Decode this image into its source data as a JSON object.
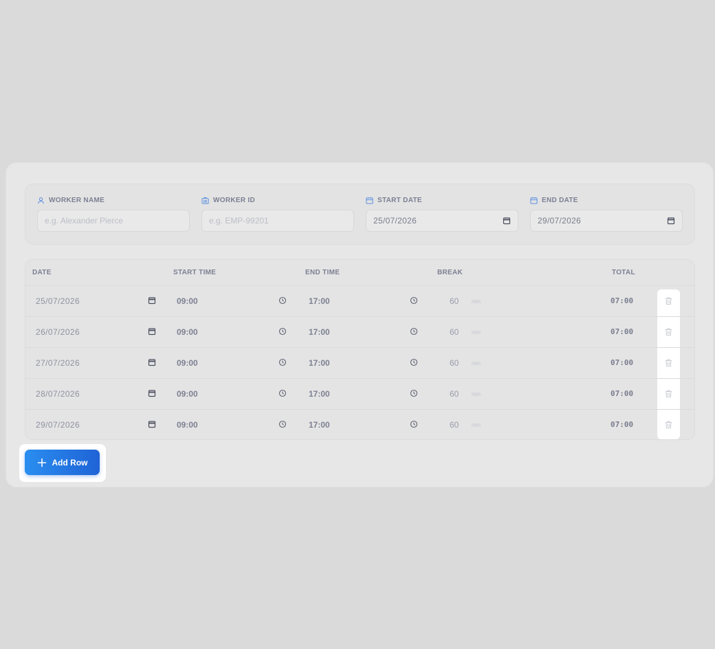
{
  "header": {
    "worker_name": {
      "label": "WORKER NAME",
      "placeholder": "e.g. Alexander Pierce",
      "value": ""
    },
    "worker_id": {
      "label": "WORKER ID",
      "placeholder": "e.g. EMP-99201",
      "value": ""
    },
    "start_date": {
      "label": "START DATE",
      "value": "25/07/2026"
    },
    "end_date": {
      "label": "END DATE",
      "value": "29/07/2026"
    }
  },
  "table": {
    "columns": {
      "date": "DATE",
      "start_time": "START TIME",
      "end_time": "END TIME",
      "break": "BREAK",
      "total": "TOTAL"
    },
    "break_unit": "min",
    "rows": [
      {
        "date": "25/07/2026",
        "start": "09:00",
        "end": "17:00",
        "break": "60",
        "total": "07:00"
      },
      {
        "date": "26/07/2026",
        "start": "09:00",
        "end": "17:00",
        "break": "60",
        "total": "07:00"
      },
      {
        "date": "27/07/2026",
        "start": "09:00",
        "end": "17:00",
        "break": "60",
        "total": "07:00"
      },
      {
        "date": "28/07/2026",
        "start": "09:00",
        "end": "17:00",
        "break": "60",
        "total": "07:00"
      },
      {
        "date": "29/07/2026",
        "start": "09:00",
        "end": "17:00",
        "break": "60",
        "total": "07:00"
      }
    ]
  },
  "actions": {
    "add_row_label": "Add Row"
  },
  "icons": {
    "worker_name": "user-icon",
    "worker_id": "id-badge-icon",
    "start_date": "calendar-icon",
    "end_date": "calendar-icon",
    "row_date": "calendar-icon",
    "row_time": "clock-icon",
    "row_delete": "trash-icon",
    "add_row": "plus-icon"
  },
  "colors": {
    "accent_start": "#2a8ef0",
    "accent_end": "#1f63d6",
    "label_icon": "#5b8fe0"
  }
}
